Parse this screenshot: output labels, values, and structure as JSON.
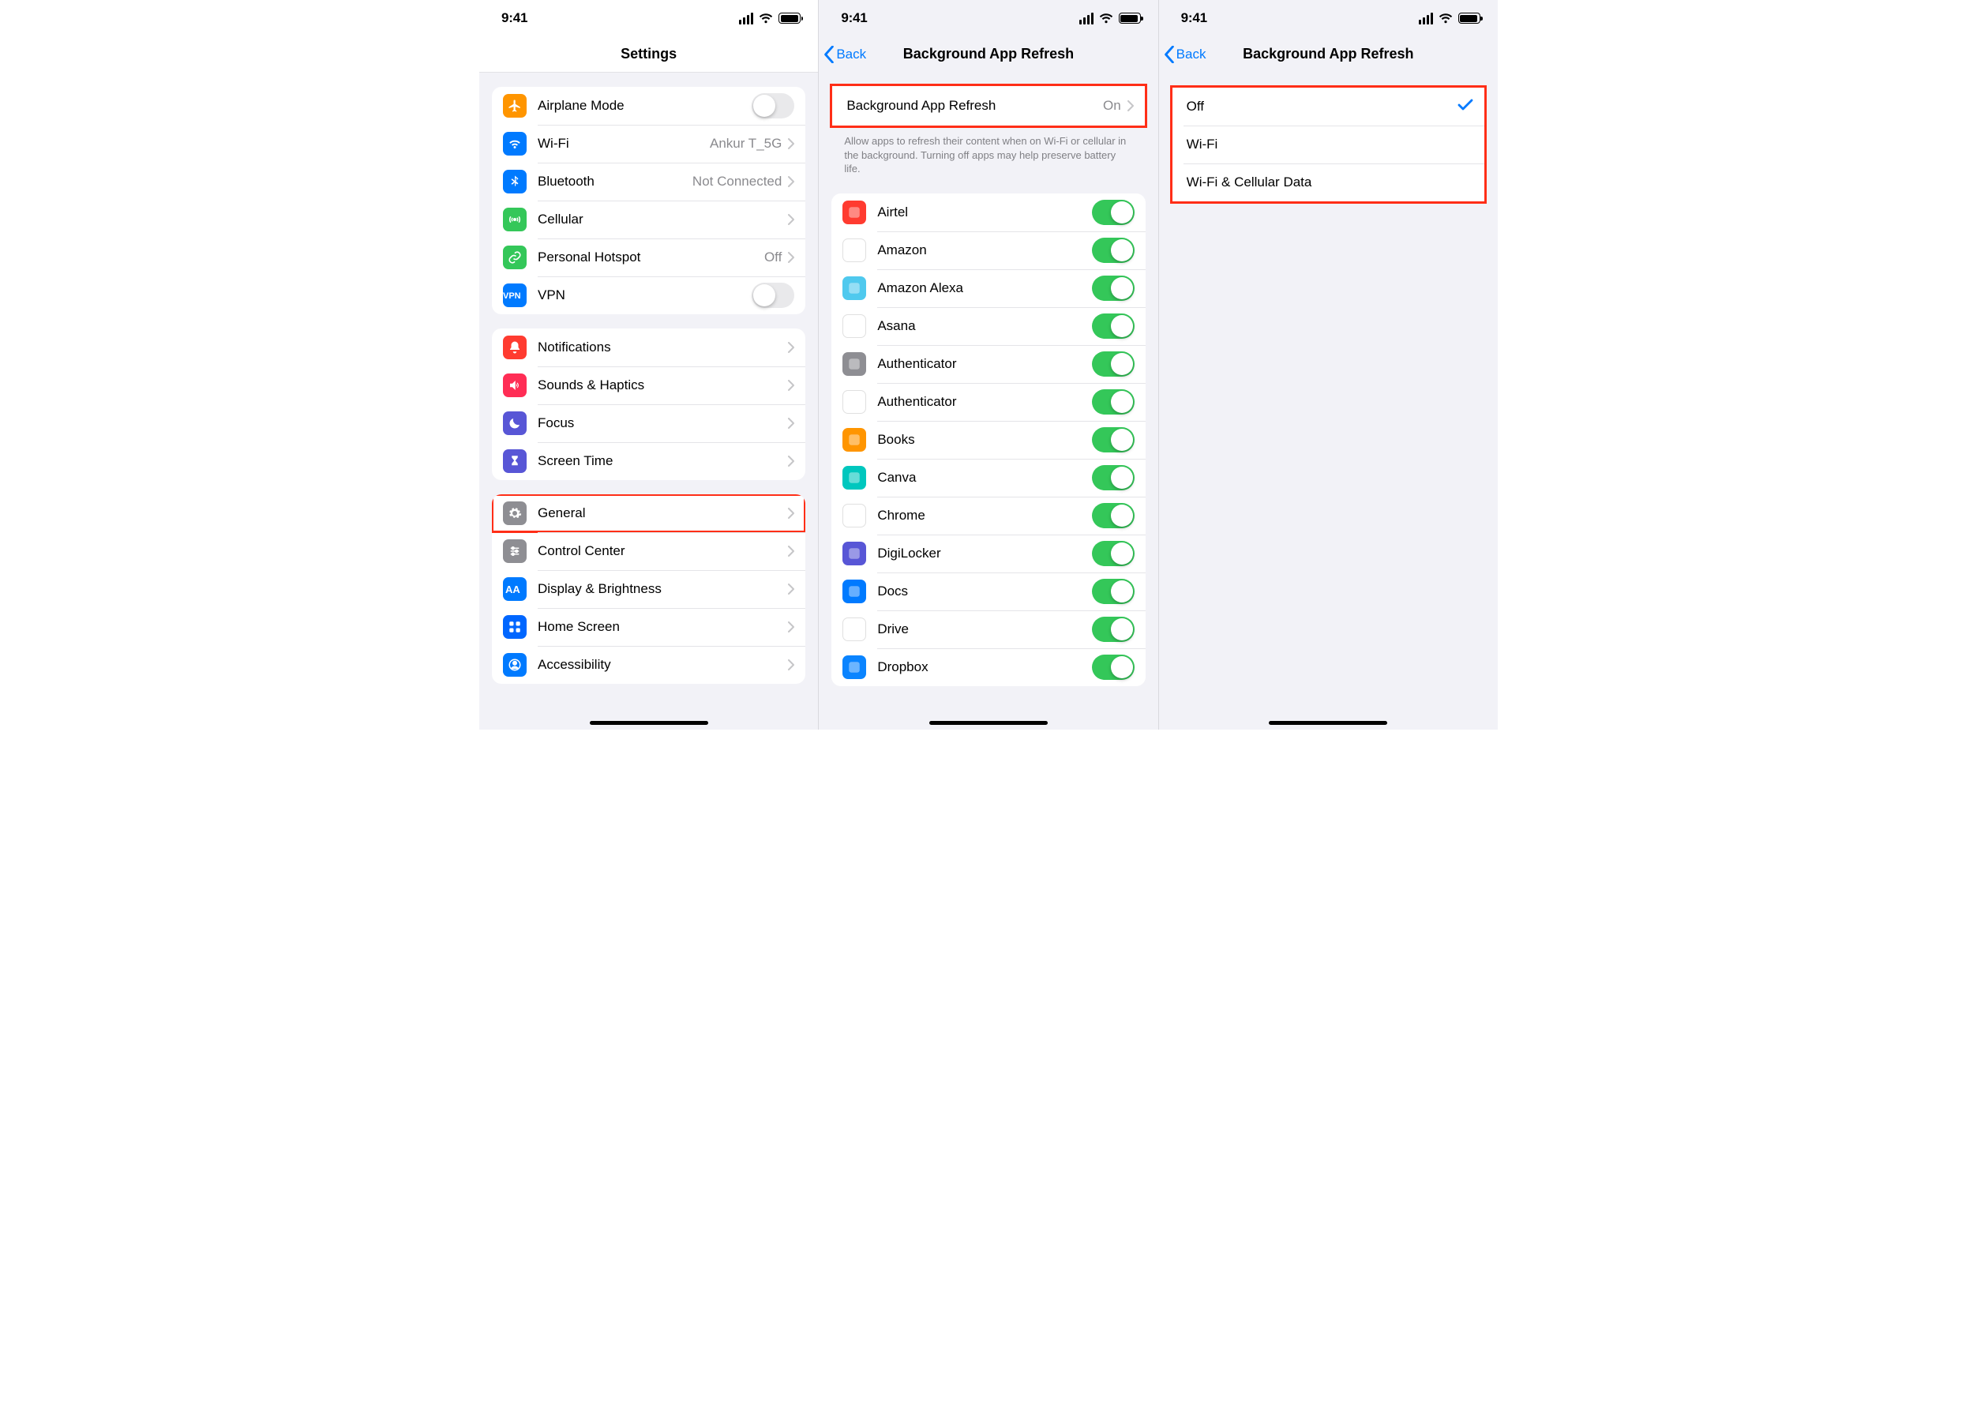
{
  "status": {
    "time": "9:41"
  },
  "screen1": {
    "title": "Settings",
    "groups": [
      {
        "rows": [
          {
            "id": "airplane",
            "icon": "airplane",
            "iconBg": "bg-orange",
            "label": "Airplane Mode",
            "toggle": false
          },
          {
            "id": "wifi",
            "icon": "wifi",
            "iconBg": "bg-blue",
            "label": "Wi-Fi",
            "value": "Ankur T_5G",
            "chevron": true
          },
          {
            "id": "bluetooth",
            "icon": "bluetooth",
            "iconBg": "bg-blue",
            "label": "Bluetooth",
            "value": "Not Connected",
            "chevron": true
          },
          {
            "id": "cellular",
            "icon": "antenna",
            "iconBg": "bg-green",
            "label": "Cellular",
            "chevron": true
          },
          {
            "id": "hotspot",
            "icon": "link",
            "iconBg": "bg-green",
            "label": "Personal Hotspot",
            "value": "Off",
            "chevron": true
          },
          {
            "id": "vpn",
            "icon": "vpn",
            "iconBg": "bg-blue",
            "label": "VPN",
            "toggle": false
          }
        ]
      },
      {
        "rows": [
          {
            "id": "notifications",
            "icon": "bell",
            "iconBg": "bg-red",
            "label": "Notifications",
            "chevron": true
          },
          {
            "id": "sounds",
            "icon": "speaker",
            "iconBg": "bg-pink",
            "label": "Sounds & Haptics",
            "chevron": true
          },
          {
            "id": "focus",
            "icon": "moon",
            "iconBg": "bg-indigo",
            "label": "Focus",
            "chevron": true
          },
          {
            "id": "screentime",
            "icon": "hourglass",
            "iconBg": "bg-indigo",
            "label": "Screen Time",
            "chevron": true
          }
        ]
      },
      {
        "rows": [
          {
            "id": "general",
            "icon": "gear",
            "iconBg": "bg-grey",
            "label": "General",
            "chevron": true,
            "highlight": true
          },
          {
            "id": "controlcenter",
            "icon": "sliders",
            "iconBg": "bg-grey",
            "label": "Control Center",
            "chevron": true
          },
          {
            "id": "display",
            "icon": "aa",
            "iconBg": "bg-blue",
            "label": "Display & Brightness",
            "chevron": true
          },
          {
            "id": "homescreen",
            "icon": "grid",
            "iconBg": "bg-bluebox",
            "label": "Home Screen",
            "chevron": true
          },
          {
            "id": "accessibility",
            "icon": "person",
            "iconBg": "bg-blue",
            "label": "Accessibility",
            "chevron": true
          }
        ]
      }
    ]
  },
  "screen2": {
    "back": "Back",
    "title": "Background App Refresh",
    "headerRow": {
      "label": "Background App Refresh",
      "value": "On"
    },
    "footer": "Allow apps to refresh their content when on Wi-Fi or cellular in the background. Turning off apps may help preserve battery life.",
    "apps": [
      {
        "id": "airtel",
        "label": "Airtel",
        "iconBg": "bg-red",
        "on": true
      },
      {
        "id": "amazon",
        "label": "Amazon",
        "iconBg": "bg-white",
        "on": true
      },
      {
        "id": "alexa",
        "label": "Amazon Alexa",
        "iconBg": "bg-aqua",
        "on": true
      },
      {
        "id": "asana",
        "label": "Asana",
        "iconBg": "bg-white",
        "on": true
      },
      {
        "id": "authenticator1",
        "label": "Authenticator",
        "iconBg": "bg-grey",
        "on": true
      },
      {
        "id": "authenticator2",
        "label": "Authenticator",
        "iconBg": "bg-white",
        "on": true
      },
      {
        "id": "books",
        "label": "Books",
        "iconBg": "bg-orange",
        "on": true
      },
      {
        "id": "canva",
        "label": "Canva",
        "iconBg": "bg-teal",
        "on": true
      },
      {
        "id": "chrome",
        "label": "Chrome",
        "iconBg": "bg-white",
        "on": true
      },
      {
        "id": "digilocker",
        "label": "DigiLocker",
        "iconBg": "bg-indigo",
        "on": true
      },
      {
        "id": "docs",
        "label": "Docs",
        "iconBg": "bg-blue",
        "on": true
      },
      {
        "id": "drive",
        "label": "Drive",
        "iconBg": "bg-white",
        "on": true
      },
      {
        "id": "dropbox",
        "label": "Dropbox",
        "iconBg": "bg-blue2",
        "on": true
      }
    ]
  },
  "screen3": {
    "back": "Back",
    "title": "Background App Refresh",
    "options": [
      {
        "id": "off",
        "label": "Off",
        "checked": true
      },
      {
        "id": "wifi",
        "label": "Wi-Fi",
        "checked": false
      },
      {
        "id": "wificell",
        "label": "Wi-Fi & Cellular Data",
        "checked": false
      }
    ]
  }
}
